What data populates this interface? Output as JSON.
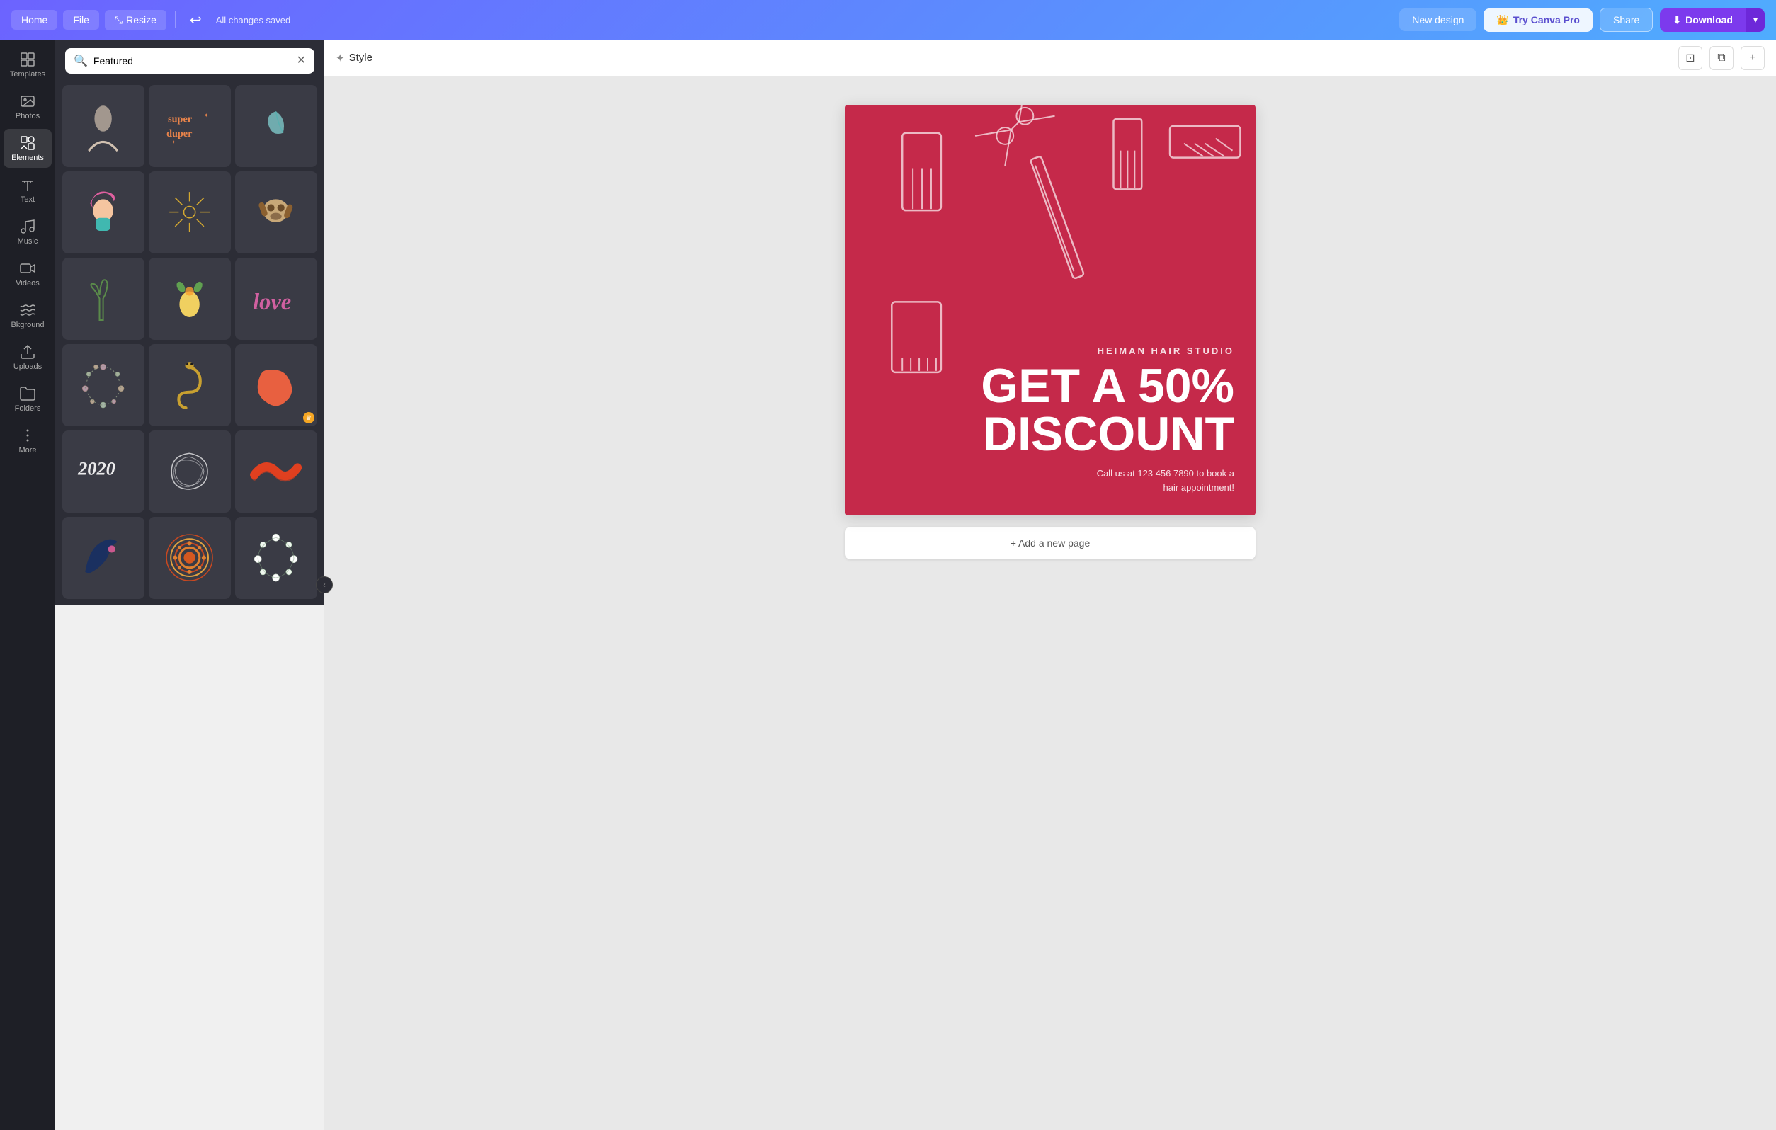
{
  "topNav": {
    "homeLabel": "Home",
    "fileLabel": "File",
    "resizeLabel": "Resize",
    "savedStatus": "All changes saved",
    "newDesignLabel": "New design",
    "tryProLabel": "Try Canva Pro",
    "shareLabel": "Share",
    "downloadLabel": "Download"
  },
  "sidebar": {
    "items": [
      {
        "id": "templates",
        "label": "Templates",
        "icon": "grid"
      },
      {
        "id": "photos",
        "label": "Photos",
        "icon": "image"
      },
      {
        "id": "elements",
        "label": "Elements",
        "icon": "shapes"
      },
      {
        "id": "text",
        "label": "Text",
        "icon": "text"
      },
      {
        "id": "music",
        "label": "Music",
        "icon": "music"
      },
      {
        "id": "videos",
        "label": "Videos",
        "icon": "video"
      },
      {
        "id": "background",
        "label": "Bkground",
        "icon": "background"
      },
      {
        "id": "uploads",
        "label": "Uploads",
        "icon": "upload"
      },
      {
        "id": "folders",
        "label": "Folders",
        "icon": "folder"
      },
      {
        "id": "more",
        "label": "More",
        "icon": "more"
      }
    ],
    "activeItem": "elements"
  },
  "panel": {
    "searchPlaceholder": "Featured",
    "searchValue": "Featured",
    "gridItems": [
      {
        "id": 1,
        "type": "woman-illustration",
        "pro": false
      },
      {
        "id": 2,
        "type": "super-duper-text",
        "pro": false
      },
      {
        "id": 3,
        "type": "leaf-illustration",
        "pro": false
      },
      {
        "id": 4,
        "type": "pink-hair-woman",
        "pro": false
      },
      {
        "id": 5,
        "type": "sunburst",
        "pro": false
      },
      {
        "id": 6,
        "type": "sloth",
        "pro": false
      },
      {
        "id": 7,
        "type": "hand-plant",
        "pro": false
      },
      {
        "id": 8,
        "type": "lemon-flowers",
        "pro": false
      },
      {
        "id": 9,
        "type": "love-script",
        "pro": false
      },
      {
        "id": 10,
        "type": "floral-wreath",
        "pro": false
      },
      {
        "id": 11,
        "type": "snake",
        "pro": false
      },
      {
        "id": 12,
        "type": "orange-blob",
        "pro": true
      },
      {
        "id": 13,
        "type": "2020-text",
        "pro": false
      },
      {
        "id": 14,
        "type": "scribble-circle",
        "pro": false
      },
      {
        "id": 15,
        "type": "red-wave",
        "pro": false
      },
      {
        "id": 16,
        "type": "dark-feather",
        "pro": false
      },
      {
        "id": 17,
        "type": "mandala",
        "pro": false
      },
      {
        "id": 18,
        "type": "flower-wreath",
        "pro": false
      }
    ]
  },
  "canvas": {
    "styleLabel": "Style",
    "design": {
      "studioName": "HEIMAN HAIR STUDIO",
      "discountTitle": "GET A 50%\nDISCOUNT",
      "callText": "Call us at 123 456 7890 to book a\nhair appointment!",
      "bgColor": "#c5294a"
    },
    "addPageLabel": "+ Add a new page"
  }
}
